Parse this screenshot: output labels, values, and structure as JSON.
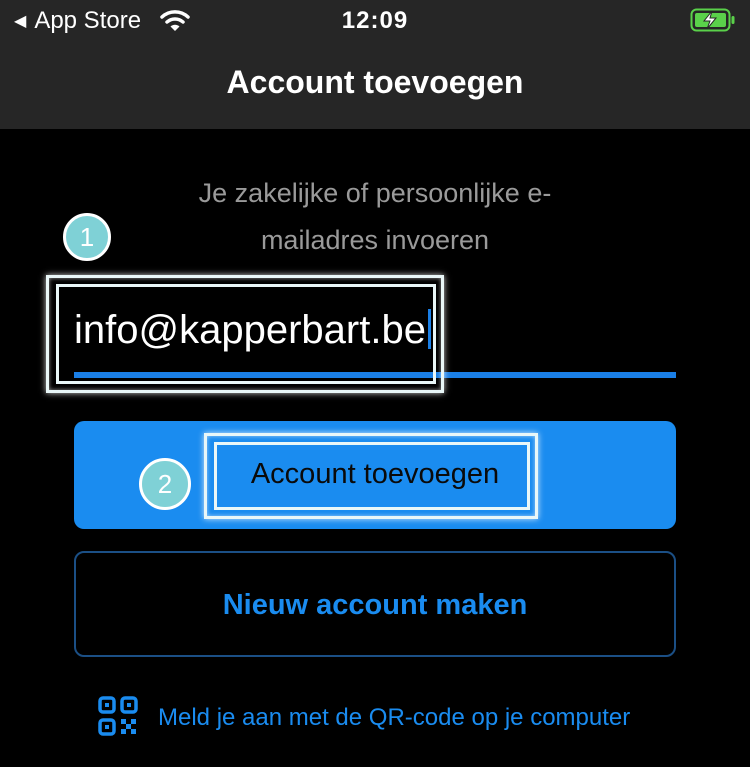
{
  "status_bar": {
    "back_label": "App Store",
    "time": "12:09",
    "icons": [
      "back-triangle-icon",
      "wifi-icon",
      "battery-charging-icon"
    ]
  },
  "nav": {
    "title": "Account toevoegen"
  },
  "prompt": {
    "line1": "Je zakelijke of persoonlijke e-",
    "line2": "mailadres invoeren"
  },
  "email": {
    "value": "info@kapperbart.be"
  },
  "steps": {
    "one": "1",
    "two": "2"
  },
  "buttons": {
    "add_account": "Account toevoegen",
    "new_account": "Nieuw account maken"
  },
  "qr": {
    "label": "Meld je aan met de QR-code op je computer",
    "icon": "qr-code-icon"
  },
  "colors": {
    "accent": "#1a8cf0",
    "bar_bg": "#262626",
    "highlight_badge": "#7fd1d6",
    "battery_green": "#5ad14a"
  }
}
